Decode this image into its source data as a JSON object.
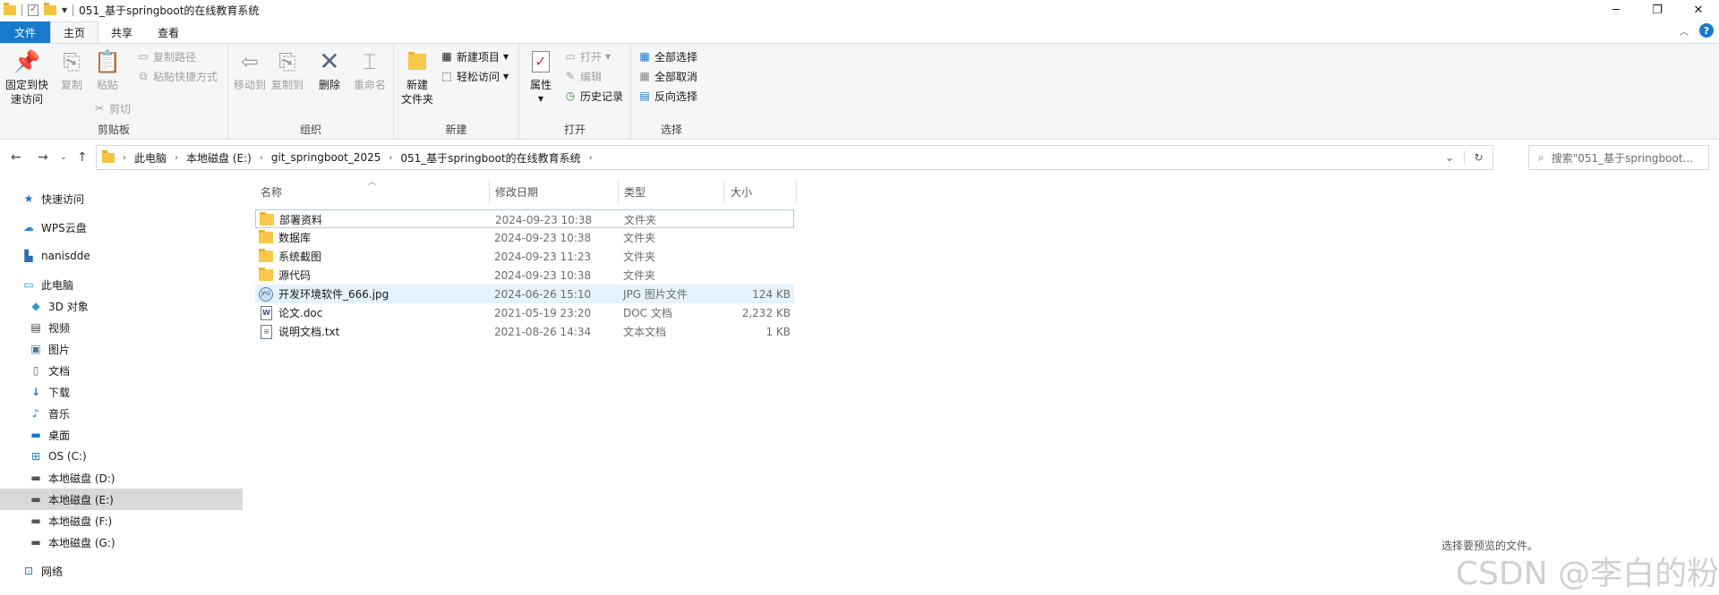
{
  "window": {
    "title": "051_基于springboot的在线教育系统",
    "controls": [
      "─",
      "❐",
      "✕"
    ]
  },
  "tabs": [
    {
      "label": "文件"
    },
    {
      "label": "主页"
    },
    {
      "label": "共享"
    },
    {
      "label": "查看"
    }
  ],
  "ribbon": {
    "clipboard": {
      "pin_label_1": "固定到快",
      "pin_label_2": "速访问",
      "copy": "复制",
      "paste": "粘贴",
      "copy_path": "复制路径",
      "paste_shortcut": "粘贴快捷方式",
      "cut": "剪切",
      "group": "剪贴板"
    },
    "organize": {
      "move_to": "移动到",
      "copy_to": "复制到",
      "delete": "删除",
      "rename": "重命名",
      "group": "组织"
    },
    "new": {
      "new_folder_1": "新建",
      "new_folder_2": "文件夹",
      "new_item": "新建项目",
      "easy_access": "轻松访问",
      "group": "新建"
    },
    "open": {
      "properties": "属性",
      "open": "打开",
      "edit": "编辑",
      "history": "历史记录",
      "group": "打开"
    },
    "select": {
      "select_all": "全部选择",
      "select_none": "全部取消",
      "invert": "反向选择",
      "group": "选择"
    }
  },
  "address": {
    "crumbs": [
      "此电脑",
      "本地磁盘 (E:)",
      "git_springboot_2025",
      "051_基于springboot的在线教育系统"
    ],
    "search_placeholder": "搜索\"051_基于springboot..."
  },
  "nav": {
    "quick_access": "快速访问",
    "wps": "WPS云盘",
    "user": "nanisdde",
    "this_pc": "此电脑",
    "items": [
      "3D 对象",
      "视频",
      "图片",
      "文档",
      "下载",
      "音乐",
      "桌面",
      "OS (C:)",
      "本地磁盘 (D:)",
      "本地磁盘 (E:)",
      "本地磁盘 (F:)",
      "本地磁盘 (G:)"
    ],
    "network": "网络"
  },
  "columns": {
    "name": "名称",
    "date": "修改日期",
    "type": "类型",
    "size": "大小"
  },
  "files": [
    {
      "name": "部署资料",
      "date": "2024-09-23 10:38",
      "type": "文件夹",
      "size": ""
    },
    {
      "name": "数据库",
      "date": "2024-09-23 10:38",
      "type": "文件夹",
      "size": ""
    },
    {
      "name": "系统截图",
      "date": "2024-09-23 11:23",
      "type": "文件夹",
      "size": ""
    },
    {
      "name": "源代码",
      "date": "2024-09-23 10:38",
      "type": "文件夹",
      "size": ""
    },
    {
      "name": "开发环境软件_666.jpg",
      "date": "2024-06-26 15:10",
      "type": "JPG 图片文件",
      "size": "124 KB"
    },
    {
      "name": "论文.doc",
      "date": "2021-05-19 23:20",
      "type": "DOC 文档",
      "size": "2,232 KB"
    },
    {
      "name": "说明文档.txt",
      "date": "2021-08-26 14:34",
      "type": "文本文档",
      "size": "1 KB"
    }
  ],
  "preview_message": "选择要预览的文件。",
  "watermark": "CSDN @李白的粉"
}
